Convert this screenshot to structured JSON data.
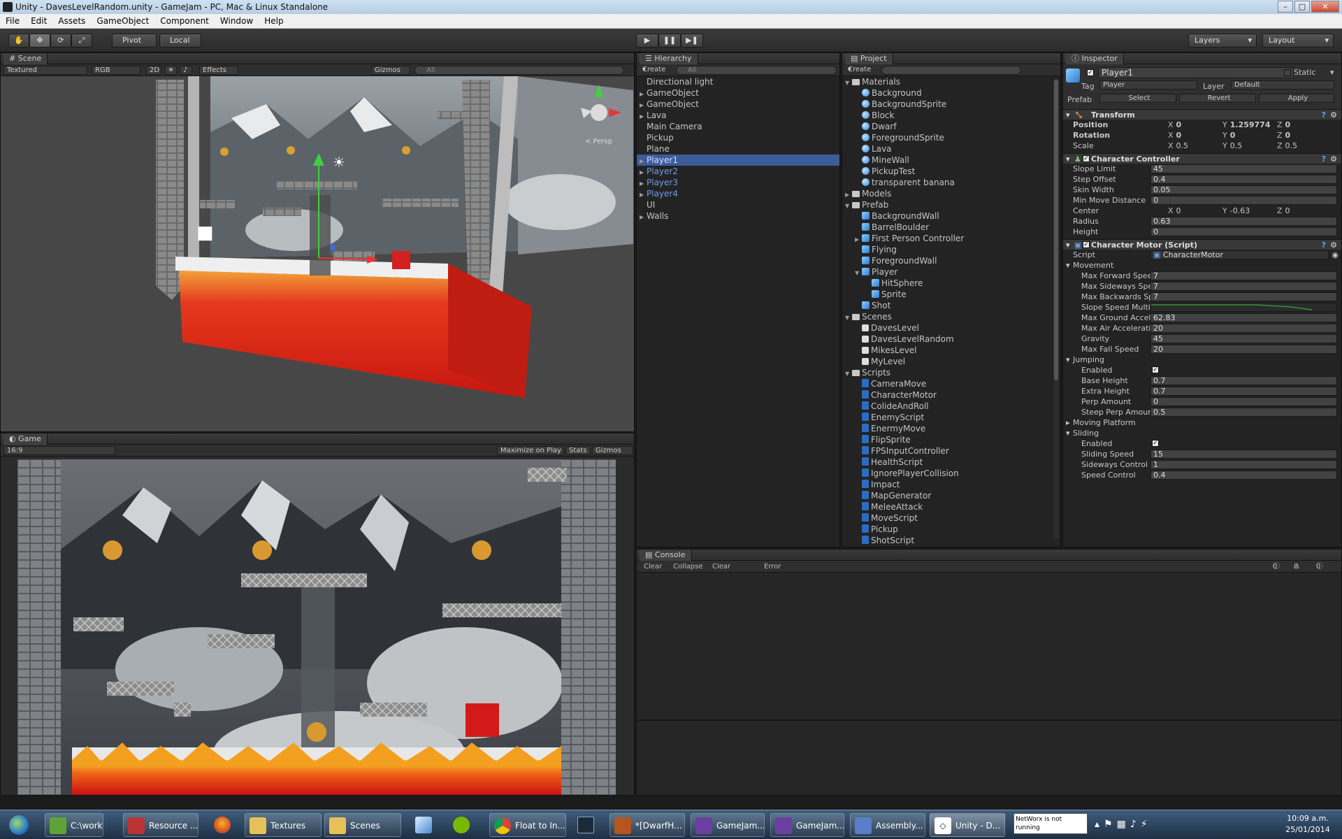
{
  "window": {
    "title": "Unity - DavesLevelRandom.unity - GameJam - PC, Mac & Linux Standalone",
    "controls": [
      "–",
      "□",
      "✕"
    ]
  },
  "menu": [
    "File",
    "Edit",
    "Assets",
    "GameObject",
    "Component",
    "Window",
    "Help"
  ],
  "toolbar": {
    "pivot": "Pivot",
    "local": "Local",
    "layers": "Layers",
    "layout": "Layout"
  },
  "scene": {
    "tab": "Scene",
    "shading": "Textured",
    "render": "RGB",
    "mode2d": "2D",
    "effects": "Effects",
    "gizmos": "Gizmos",
    "search_placeholder": "All",
    "persp": "< Persp"
  },
  "game": {
    "tab": "Game",
    "aspect": "16:9",
    "maximize": "Maximize on Play",
    "stats": "Stats",
    "gizmos": "Gizmos"
  },
  "hierarchy": {
    "tab": "Hierarchy",
    "create": "Create",
    "search_placeholder": "All",
    "items": [
      {
        "label": "Directional light",
        "expandable": false
      },
      {
        "label": "GameObject",
        "expandable": true
      },
      {
        "label": "GameObject",
        "expandable": true
      },
      {
        "label": "Lava",
        "expandable": true
      },
      {
        "label": "Main Camera",
        "expandable": false
      },
      {
        "label": "Pickup",
        "expandable": false
      },
      {
        "label": "Plane",
        "expandable": false
      },
      {
        "label": "Player1",
        "expandable": true,
        "selected": true
      },
      {
        "label": "Player2",
        "expandable": true
      },
      {
        "label": "Player3",
        "expandable": true
      },
      {
        "label": "Player4",
        "expandable": true
      },
      {
        "label": "UI",
        "expandable": false
      },
      {
        "label": "Walls",
        "expandable": true
      }
    ]
  },
  "project": {
    "tab": "Project",
    "create": "Create",
    "items": [
      {
        "label": "Materials",
        "type": "folder",
        "depth": 0
      },
      {
        "label": "Background",
        "type": "mat",
        "depth": 1
      },
      {
        "label": "BackgroundSprite",
        "type": "mat",
        "depth": 1
      },
      {
        "label": "Block",
        "type": "mat",
        "depth": 1
      },
      {
        "label": "Dwarf",
        "type": "mat",
        "depth": 1
      },
      {
        "label": "ForegroundSprite",
        "type": "mat",
        "depth": 1
      },
      {
        "label": "Lava",
        "type": "mat",
        "depth": 1
      },
      {
        "label": "MineWall",
        "type": "mat",
        "depth": 1
      },
      {
        "label": "PickupTest",
        "type": "mat",
        "depth": 1
      },
      {
        "label": "transparent banana",
        "type": "mat",
        "depth": 1
      },
      {
        "label": "Models",
        "type": "folder",
        "depth": 0
      },
      {
        "label": "Prefab",
        "type": "folder",
        "depth": 0
      },
      {
        "label": "BackgroundWall",
        "type": "prefab",
        "depth": 1
      },
      {
        "label": "BarrelBoulder",
        "type": "prefab",
        "depth": 1
      },
      {
        "label": "First Person Controller",
        "type": "prefab",
        "depth": 1
      },
      {
        "label": "Flying",
        "type": "prefab",
        "depth": 1
      },
      {
        "label": "ForegroundWall",
        "type": "prefab",
        "depth": 1
      },
      {
        "label": "Player",
        "type": "prefab",
        "depth": 1
      },
      {
        "label": "HitSphere",
        "type": "prefab",
        "depth": 2
      },
      {
        "label": "Sprite",
        "type": "prefab",
        "depth": 2
      },
      {
        "label": "Shot",
        "type": "prefab",
        "depth": 1
      },
      {
        "label": "Scenes",
        "type": "folder",
        "depth": 0
      },
      {
        "label": "DavesLevel",
        "type": "scene",
        "depth": 1
      },
      {
        "label": "DavesLevelRandom",
        "type": "scene",
        "depth": 1
      },
      {
        "label": "MikesLevel",
        "type": "scene",
        "depth": 1
      },
      {
        "label": "MyLevel",
        "type": "scene",
        "depth": 1
      },
      {
        "label": "Scripts",
        "type": "folder",
        "depth": 0
      },
      {
        "label": "CameraMove",
        "type": "script",
        "depth": 1
      },
      {
        "label": "CharacterMotor",
        "type": "script",
        "depth": 1
      },
      {
        "label": "ColideAndRoll",
        "type": "script",
        "depth": 1
      },
      {
        "label": "EnemyScript",
        "type": "script",
        "depth": 1
      },
      {
        "label": "EnermyMove",
        "type": "script",
        "depth": 1
      },
      {
        "label": "FlipSprite",
        "type": "script",
        "depth": 1
      },
      {
        "label": "FPSInputController",
        "type": "script",
        "depth": 1
      },
      {
        "label": "HealthScript",
        "type": "script",
        "depth": 1
      },
      {
        "label": "IgnorePlayerCollision",
        "type": "script",
        "depth": 1
      },
      {
        "label": "Impact",
        "type": "script",
        "depth": 1
      },
      {
        "label": "MapGenerator",
        "type": "script",
        "depth": 1
      },
      {
        "label": "MeleeAttack",
        "type": "script",
        "depth": 1
      },
      {
        "label": "MoveScript",
        "type": "script",
        "depth": 1
      },
      {
        "label": "Pickup",
        "type": "script",
        "depth": 1
      },
      {
        "label": "ShotScript",
        "type": "script",
        "depth": 1
      }
    ]
  },
  "inspector": {
    "tab": "Inspector",
    "object_name": "Player1",
    "static": "Static",
    "tag_label": "Tag",
    "tag_value": "Player",
    "layer_label": "Layer",
    "layer_value": "Default",
    "prefab_label": "Prefab",
    "select": "Select",
    "revert": "Revert",
    "apply": "Apply",
    "transform": {
      "title": "Transform",
      "position": {
        "label": "Position",
        "x": "0",
        "y": "1.259774",
        "z": "0"
      },
      "rotation": {
        "label": "Rotation",
        "x": "0",
        "y": "0",
        "z": "0"
      },
      "scale": {
        "label": "Scale",
        "x": "0.5",
        "y": "0.5",
        "z": "0.5"
      }
    },
    "character_controller": {
      "title": "Character Controller",
      "slope_limit": {
        "label": "Slope Limit",
        "value": "45"
      },
      "step_offset": {
        "label": "Step Offset",
        "value": "0.4"
      },
      "skin_width": {
        "label": "Skin Width",
        "value": "0.05"
      },
      "min_move": {
        "label": "Min Move Distance",
        "value": "0"
      },
      "center": {
        "label": "Center",
        "x": "0",
        "y": "-0.63",
        "z": "0"
      },
      "radius": {
        "label": "Radius",
        "value": "0.63"
      },
      "height": {
        "label": "Height",
        "value": "0"
      }
    },
    "character_motor": {
      "title": "Character Motor (Script)",
      "script_label": "Script",
      "script_value": "CharacterMotor",
      "movement": "Movement",
      "max_forward": {
        "label": "Max Forward Speed",
        "value": "7"
      },
      "max_sideways": {
        "label": "Max Sideways Speed",
        "value": "7"
      },
      "max_backwards": {
        "label": "Max Backwards Spe",
        "value": "7"
      },
      "slope_mult": {
        "label": "Slope Speed Multipli"
      },
      "max_ground_accel": {
        "label": "Max Ground Acceler",
        "value": "62.83"
      },
      "max_air_accel": {
        "label": "Max Air Acceleration",
        "value": "20"
      },
      "gravity": {
        "label": "Gravity",
        "value": "45"
      },
      "max_fall": {
        "label": "Max Fall Speed",
        "value": "20"
      },
      "jumping": "Jumping",
      "jump_enabled": {
        "label": "Enabled"
      },
      "base_height": {
        "label": "Base Height",
        "value": "0.7"
      },
      "extra_height": {
        "label": "Extra Height",
        "value": "0.7"
      },
      "perp_amount": {
        "label": "Perp Amount",
        "value": "0"
      },
      "steep_perp": {
        "label": "Steep Perp Amount",
        "value": "0.5"
      },
      "moving_platform": "Moving Platform",
      "sliding": "Sliding",
      "slide_enabled": {
        "label": "Enabled"
      },
      "sliding_speed": {
        "label": "Sliding Speed",
        "value": "15"
      },
      "sideways_control": {
        "label": "Sideways Control",
        "value": "1"
      },
      "speed_control": {
        "label": "Speed Control",
        "value": "0.4"
      }
    }
  },
  "console": {
    "tab": "Console",
    "clear": "Clear",
    "collapse": "Collapse",
    "clear_on_play": "Clear on Play",
    "error_pause": "Error Pause",
    "info_count": "0",
    "warn_count": "0",
    "error_count": "0"
  },
  "taskbar": {
    "items": [
      {
        "label": "C:\\work\\S...",
        "color": "#5fa336"
      },
      {
        "label": "Resource ...",
        "color": "#b33"
      },
      {
        "label": "Textures",
        "color": "#e6c15a"
      },
      {
        "label": "Scenes",
        "color": "#e6c15a"
      },
      {
        "label": "Float to In...",
        "color": "#3b8ee8"
      },
      {
        "label": "*[DwarfH...",
        "color": "#b5561e"
      },
      {
        "label": "GameJam...",
        "color": "#6b3fa0"
      },
      {
        "label": "GameJam...",
        "color": "#6b3fa0"
      },
      {
        "label": "Assembly...",
        "color": "#5a7ec8"
      },
      {
        "label": "Unity - D...",
        "color": "#222"
      }
    ],
    "tooltip": "NetWorx is not running",
    "time": "10:09 a.m.",
    "date": "25/01/2014"
  }
}
